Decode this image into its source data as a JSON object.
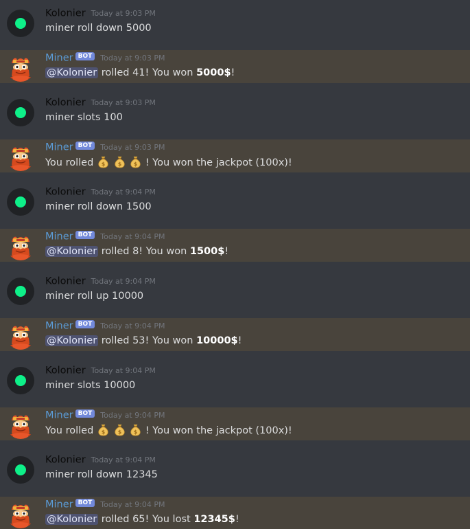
{
  "colors": {
    "background": "#36393f",
    "mention_highlight": "#49443c",
    "bot_name": "#5b9bd6",
    "bot_badge": "#7289da",
    "user_name": "#0a0a0a",
    "user_avatar_dot": "#0ef089"
  },
  "bot_badge_label": "BOT",
  "messages": [
    {
      "author": "Kolonier",
      "is_bot": false,
      "time": "Today at 9:03 PM",
      "text": "miner roll down 5000"
    },
    {
      "author": "Miner",
      "is_bot": true,
      "time": "Today at 9:03 PM",
      "mention": "@Kolonier",
      "pre": " rolled 41! You won ",
      "amount": "5000$",
      "post": "!"
    },
    {
      "author": "Kolonier",
      "is_bot": false,
      "time": "Today at 9:03 PM",
      "text": "miner slots 100"
    },
    {
      "author": "Miner",
      "is_bot": true,
      "time": "Today at 9:03 PM",
      "pre": "You rolled ",
      "emojis": [
        "money-bag-icon",
        "money-bag-icon",
        "money-bag-icon"
      ],
      "post": "! You won the jackpot (100x)!"
    },
    {
      "author": "Kolonier",
      "is_bot": false,
      "time": "Today at 9:04 PM",
      "text": "miner roll down 1500"
    },
    {
      "author": "Miner",
      "is_bot": true,
      "time": "Today at 9:04 PM",
      "mention": "@Kolonier",
      "pre": " rolled 8! You won ",
      "amount": "1500$",
      "post": "!"
    },
    {
      "author": "Kolonier",
      "is_bot": false,
      "time": "Today at 9:04 PM",
      "text": "miner roll up 10000"
    },
    {
      "author": "Miner",
      "is_bot": true,
      "time": "Today at 9:04 PM",
      "mention": "@Kolonier",
      "pre": " rolled 53! You won ",
      "amount": "10000$",
      "post": "!"
    },
    {
      "author": "Kolonier",
      "is_bot": false,
      "time": "Today at 9:04 PM",
      "text": "miner slots 10000"
    },
    {
      "author": "Miner",
      "is_bot": true,
      "time": "Today at 9:04 PM",
      "pre": "You rolled ",
      "emojis": [
        "money-bag-icon",
        "money-bag-icon",
        "money-bag-icon"
      ],
      "post": "! You won the jackpot (100x)!"
    },
    {
      "author": "Kolonier",
      "is_bot": false,
      "time": "Today at 9:04 PM",
      "text": "miner roll down 12345"
    },
    {
      "author": "Miner",
      "is_bot": true,
      "time": "Today at 9:04 PM",
      "mention": "@Kolonier",
      "pre": " rolled 65! You lost ",
      "amount": "12345$",
      "post": "!"
    }
  ]
}
